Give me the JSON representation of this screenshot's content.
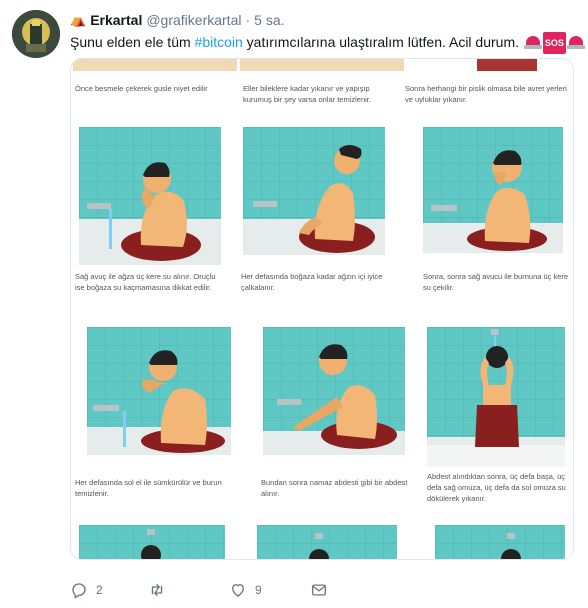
{
  "tweet": {
    "author_emoji": "⛺",
    "author_name": "Erkartal",
    "author_handle": "@grafikerkartal",
    "separator": "·",
    "time": "5 sa.",
    "text_before": "Şunu elden ele tüm ",
    "hashtag": "#bitcoin",
    "text_after": " yatırımcılarına ulaştıralım lütfen. Acil durum. ",
    "sos_label": "SOS"
  },
  "captions": {
    "top": [
      "Önce besmele çekerek gusle niyet edilir",
      "Eller bileklere kadar yıkanır ve yapışıp kurumuş bir şey varsa onlar temizlenir.",
      "Sonra herhangi bir pislik olmasa bile avret yerleri  ve uyluklar yıkanır."
    ],
    "row1": [
      "Sağ avuç ile ağza üç kere su alınır. Oruçlu ise boğaza su kaçmamasına dikkat edilir.",
      "Her defasında boğaza kadar ağzın içi iyice çalkalanır.",
      "Sonra, sonra sağ avucu ile burnuna üç kere su çekilir."
    ],
    "row2": [
      "Her defasında sol el ile sümkürülür ve burun temizlenir.",
      "Bundan sonra namaz abdesti gibi bir abdest alınır.",
      "Abdest alındıktan sonra, üç defa başa, üç defa sağ omuza, üç defa da sol omuza su dökülerek yıkanır."
    ]
  },
  "actions": {
    "reply_count": "2",
    "retweet_count": "",
    "like_count": "9"
  },
  "colors": {
    "accent": "#1da1f2",
    "scene_bg": "#5fc7c4",
    "emoji_red": "#e0245e"
  }
}
